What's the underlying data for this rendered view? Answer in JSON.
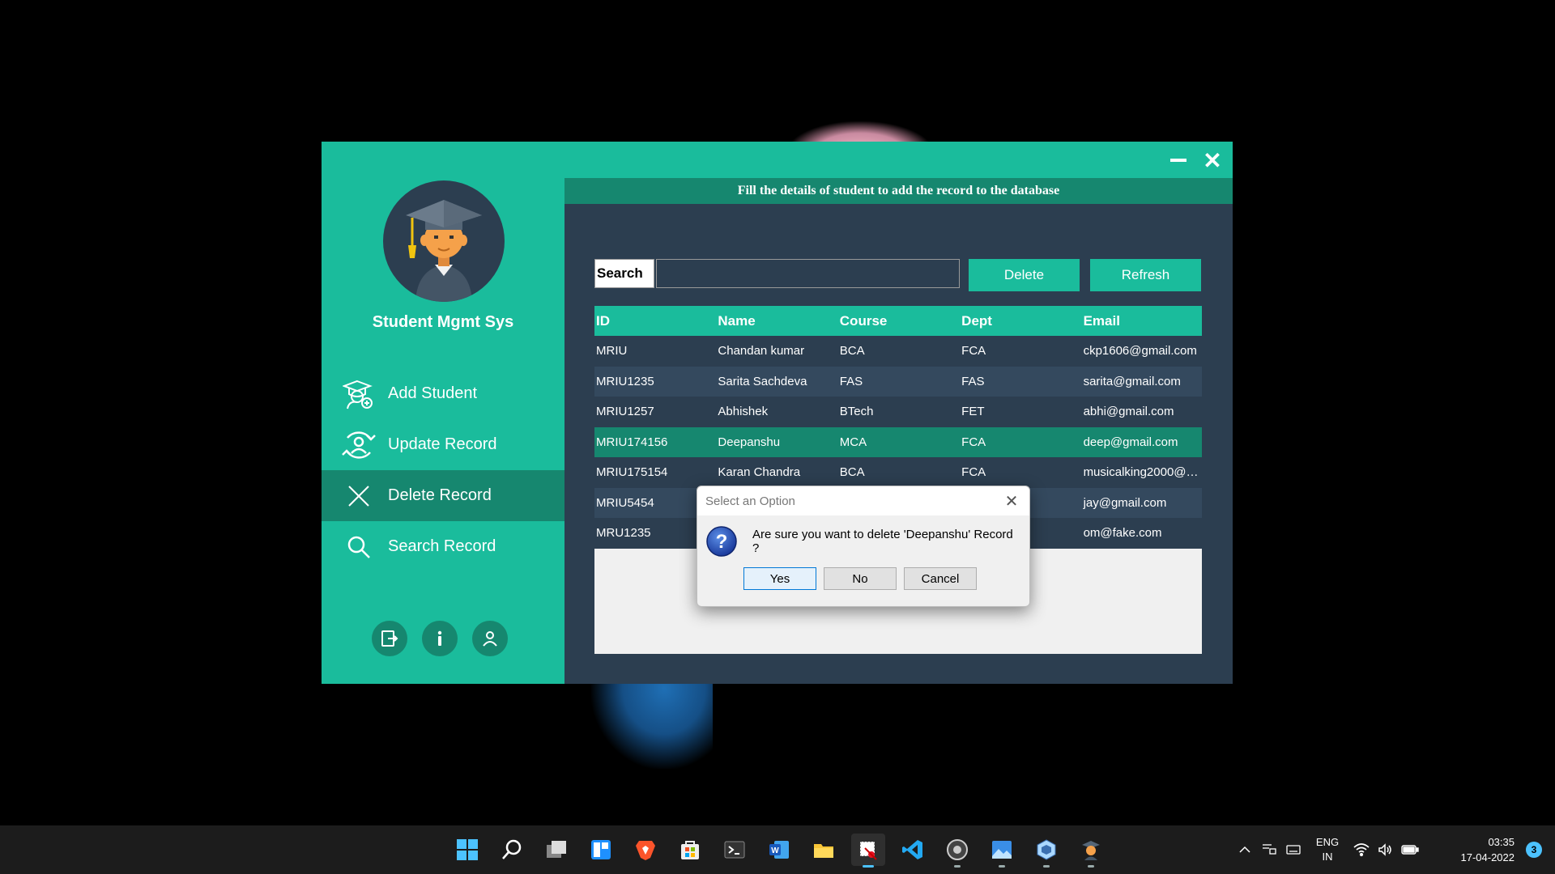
{
  "window": {
    "minimize_icon": "minimize-icon",
    "close_symbol": "✕"
  },
  "sidebar": {
    "app_title": "Student Mgmt Sys",
    "avatar_icon": "graduate-avatar-icon",
    "items": [
      {
        "label": "Add Student",
        "icon": "add-student-icon",
        "active": false
      },
      {
        "label": "Update Record",
        "icon": "update-record-icon",
        "active": false
      },
      {
        "label": "Delete Record",
        "icon": "close-x-icon",
        "active": true
      },
      {
        "label": "Search Record",
        "icon": "search-icon",
        "active": false
      }
    ],
    "bottom_icons": [
      "logout-icon",
      "info-icon",
      "user-icon"
    ]
  },
  "main": {
    "banner": "Fill the details of student to add the record to the database",
    "search_label": "Search",
    "search_value": "",
    "delete_label": "Delete",
    "refresh_label": "Refresh"
  },
  "table": {
    "columns": [
      "ID",
      "Name",
      "Course",
      "Dept",
      "Email"
    ],
    "rows": [
      [
        "MRIU",
        "Chandan kumar",
        "BCA",
        "FCA",
        "ckp1606@gmail.com"
      ],
      [
        "MRIU1235",
        "Sarita Sachdeva",
        "FAS",
        "FAS",
        "sarita@gmail.com"
      ],
      [
        "MRIU1257",
        "Abhishek",
        "BTech",
        "FET",
        "abhi@gmail.com"
      ],
      [
        "MRIU174156",
        "Deepanshu",
        "MCA",
        "FCA",
        "deep@gmail.com"
      ],
      [
        "MRIU175154",
        "Karan Chandra",
        "BCA",
        "FCA",
        "musicalking2000@g..."
      ],
      [
        "MRIU5454",
        "",
        "",
        "",
        "jay@gmail.com"
      ],
      [
        "MRU1235",
        "",
        "",
        "",
        "om@fake.com"
      ]
    ],
    "selected_row": 3
  },
  "dialog": {
    "title": "Select an Option",
    "message": "Are sure you want to delete 'Deepanshu' Record ?",
    "icon": "question-icon",
    "buttons": {
      "yes": "Yes",
      "no": "No",
      "cancel": "Cancel"
    }
  },
  "taskbar": {
    "apps": [
      "windows-start-icon",
      "search-icon",
      "task-view-icon",
      "widgets-icon",
      "brave-browser-icon",
      "microsoft-store-icon",
      "terminal-icon",
      "word-icon",
      "file-explorer-icon",
      "snipping-tool-icon",
      "vscode-icon",
      "obs-icon",
      "photos-icon",
      "virtualbox-icon",
      "java-app-icon"
    ],
    "lang_top": "ENG",
    "lang_bottom": "IN",
    "time": "03:35",
    "date": "17-04-2022",
    "notifications": "3"
  }
}
